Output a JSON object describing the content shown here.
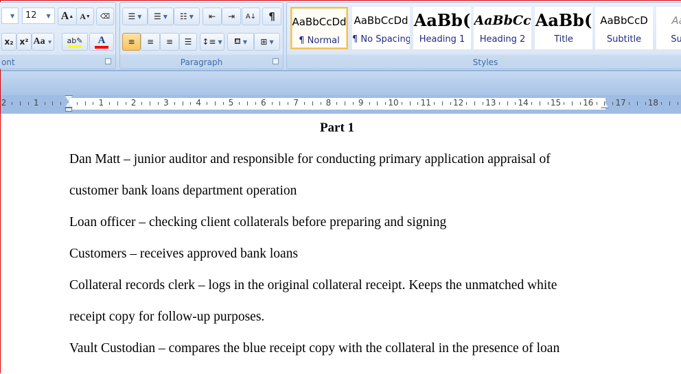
{
  "ribbon": {
    "font_group": {
      "label": "ont",
      "font_size": "12",
      "grow": "A",
      "shrink": "A",
      "subscript": "x₂",
      "superscript": "x²",
      "change_case": "Aa",
      "highlight_color": "#ffff00",
      "font_color": "#ff0000",
      "font_color_label": "A"
    },
    "paragraph_group": {
      "label": "Paragraph",
      "show_marks": "¶"
    },
    "styles_group": {
      "label": "Styles",
      "items": [
        {
          "sample": "AaBbCcDd",
          "name": "¶ Normal",
          "selected": true
        },
        {
          "sample": "AaBbCcDd",
          "name": "¶ No Spacing"
        },
        {
          "sample": "AaBb(",
          "name": "Heading 1"
        },
        {
          "sample": "AaBbCc",
          "name": "Heading 2"
        },
        {
          "sample": "AaBb(",
          "name": "Title"
        },
        {
          "sample": "AaBbCcD",
          "name": "Subtitle"
        },
        {
          "sample": "AaBb",
          "name": "Subtle"
        }
      ]
    }
  },
  "ruler": {
    "left": [
      "2",
      "1"
    ],
    "numbers": [
      "1",
      "2",
      "3",
      "4",
      "5",
      "6",
      "7",
      "8",
      "9",
      "10",
      "11",
      "12",
      "13",
      "14",
      "15",
      "16",
      "17",
      "18"
    ]
  },
  "document": {
    "title": "Part 1",
    "lines": [
      "Dan Matt – junior auditor and responsible for conducting primary application appraisal of",
      "customer bank loans department operation",
      "Loan officer – checking client collaterals before preparing and signing",
      "Customers – receives approved bank loans",
      "Collateral records clerk – logs in the original collateral receipt. Keeps the unmatched white",
      "receipt copy for follow-up purposes.",
      "Vault Custodian – compares the blue receipt copy with the collateral in the presence of loan"
    ]
  }
}
